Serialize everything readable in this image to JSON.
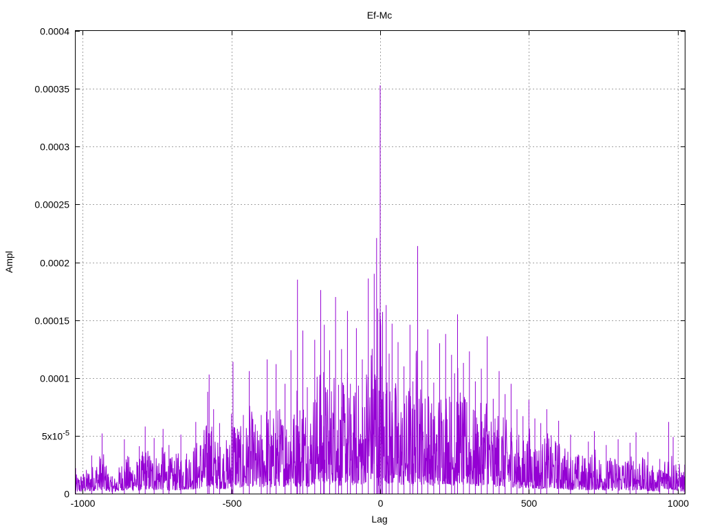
{
  "chart_data": {
    "type": "line",
    "title": "Ef-Mc",
    "xlabel": "Lag",
    "ylabel": "Ampl",
    "xlim": [
      -1024,
      1024
    ],
    "ylim": [
      0,
      0.0004
    ],
    "grid": true,
    "legend": "none",
    "x_ticks": [
      {
        "value": -1000,
        "label": "-1000"
      },
      {
        "value": -500,
        "label": "-500"
      },
      {
        "value": 0,
        "label": "0"
      },
      {
        "value": 500,
        "label": "500"
      },
      {
        "value": 1000,
        "label": "1000"
      }
    ],
    "y_ticks": [
      {
        "value": 0,
        "label": "0",
        "exp": ""
      },
      {
        "value": 5e-05,
        "label": "5x10",
        "exp": "-5"
      },
      {
        "value": 0.0001,
        "label": "0.0001",
        "exp": ""
      },
      {
        "value": 0.00015,
        "label": "0.00015",
        "exp": ""
      },
      {
        "value": 0.0002,
        "label": "0.0002",
        "exp": ""
      },
      {
        "value": 0.00025,
        "label": "0.00025",
        "exp": ""
      },
      {
        "value": 0.0003,
        "label": "0.0003",
        "exp": ""
      },
      {
        "value": 0.00035,
        "label": "0.00035",
        "exp": ""
      },
      {
        "value": 0.0004,
        "label": "0.0004",
        "exp": ""
      }
    ],
    "series": [
      {
        "color": "#9400d3",
        "x": [
          -1024,
          -970,
          -935,
          -900,
          -860,
          -810,
          -790,
          -760,
          -730,
          -710,
          -670,
          -620,
          -580,
          -575,
          -560,
          -540,
          -500,
          -495,
          -460,
          -440,
          -400,
          -380,
          -370,
          -350,
          -320,
          -300,
          -280,
          -278,
          -270,
          -260,
          -245,
          -220,
          -200,
          -190,
          -188,
          -170,
          -150,
          -140,
          -130,
          -110,
          -100,
          -80,
          -60,
          -40,
          -20,
          -12,
          -8,
          -4,
          0,
          4,
          8,
          20,
          30,
          40,
          60,
          80,
          100,
          110,
          126,
          140,
          160,
          180,
          200,
          220,
          240,
          250,
          260,
          280,
          300,
          320,
          340,
          360,
          380,
          400,
          420,
          440,
          460,
          480,
          500,
          520,
          540,
          560,
          600,
          640,
          700,
          720,
          760,
          800,
          840,
          860,
          900,
          940,
          970,
          985,
          1024
        ],
        "y": [
          2.2e-05,
          3.3e-05,
          5.2e-05,
          1.5e-05,
          4.7e-05,
          4.1e-05,
          5.8e-05,
          4.8e-05,
          5.6e-05,
          4.2e-05,
          5.1e-05,
          6.2e-05,
          8.8e-05,
          0.000103,
          7.3e-05,
          6.1e-05,
          6.9e-05,
          0.000114,
          6.8e-05,
          0.000106,
          6.8e-05,
          0.000116,
          7.2e-05,
          0.000112,
          9.5e-05,
          0.000124,
          8.9e-05,
          0.000185,
          7.2e-05,
          0.000141,
          9.2e-05,
          0.000133,
          0.000176,
          0.000105,
          0.000146,
          0.000124,
          0.00017,
          9.4e-05,
          0.000125,
          0.000158,
          9.5e-05,
          0.000143,
          0.000116,
          0.000186,
          0.00019,
          0.000221,
          0.00016,
          8.9e-05,
          0.000353,
          0.00011,
          0.000157,
          0.000163,
          0.000121,
          0.000147,
          0.000131,
          0.00011,
          0.000146,
          9.7e-05,
          0.000214,
          0.000115,
          0.000142,
          9.6e-05,
          0.00013,
          0.000138,
          0.00012,
          0.000104,
          0.000155,
          0.000113,
          0.000123,
          9.7e-05,
          0.000108,
          0.000136,
          8.2e-05,
          0.000106,
          8.6e-05,
          9.5e-05,
          7.3e-05,
          6.7e-05,
          8.1e-05,
          6.5e-05,
          6.1e-05,
          7.3e-05,
          6.3e-05,
          5.1e-05,
          4.5e-05,
          5.4e-05,
          4.2e-05,
          4.7e-05,
          4.4e-05,
          5.3e-05,
          3.6e-05,
          3e-05,
          6.2e-05,
          4.9e-05,
          2.5e-05
        ]
      }
    ]
  }
}
